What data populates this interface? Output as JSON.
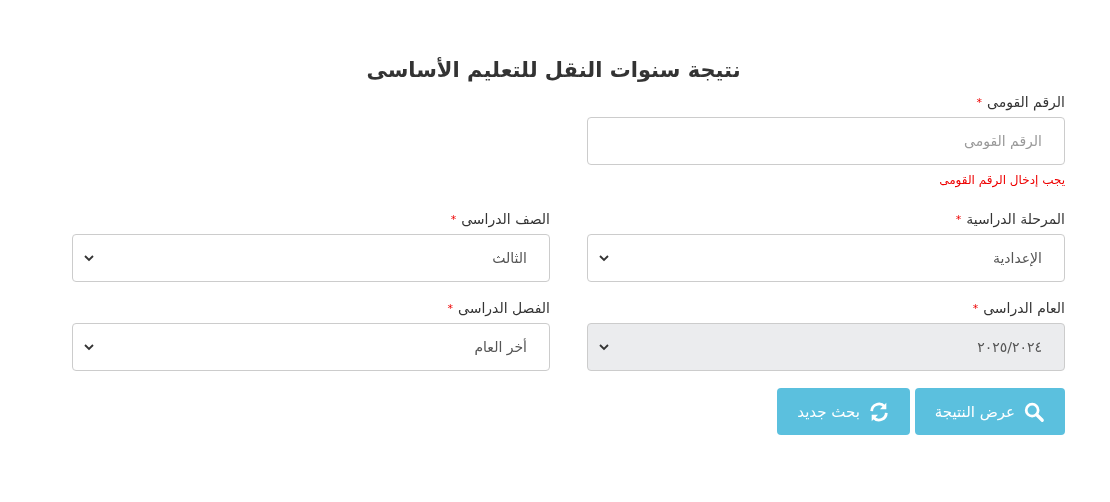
{
  "title": "نتيجة سنوات النقل للتعليم الأساسى",
  "fields": [
    {
      "kind": "input",
      "label": "الرقم القومى",
      "required_mark": "*",
      "placeholder": "الرقم القومى",
      "error": "يجب إدخال الرقم القومى"
    },
    {
      "kind": "spacer"
    },
    {
      "kind": "select",
      "label": "المرحلة الدراسية",
      "required_mark": "*",
      "value": "الإعدادية",
      "disabled": false
    },
    {
      "kind": "select",
      "label": "الصف الدراسى",
      "required_mark": "*",
      "value": "الثالث",
      "disabled": false
    },
    {
      "kind": "select",
      "label": "العام الدراسى",
      "required_mark": "*",
      "value": "٢٠٢٥/٢٠٢٤",
      "disabled": true
    },
    {
      "kind": "select",
      "label": "الفصل الدراسى",
      "required_mark": "*",
      "value": "أخر العام",
      "disabled": false
    }
  ],
  "buttons": [
    {
      "label": "عرض النتيجة",
      "kind": "search"
    },
    {
      "label": "بحث جديد",
      "kind": "refresh"
    }
  ]
}
